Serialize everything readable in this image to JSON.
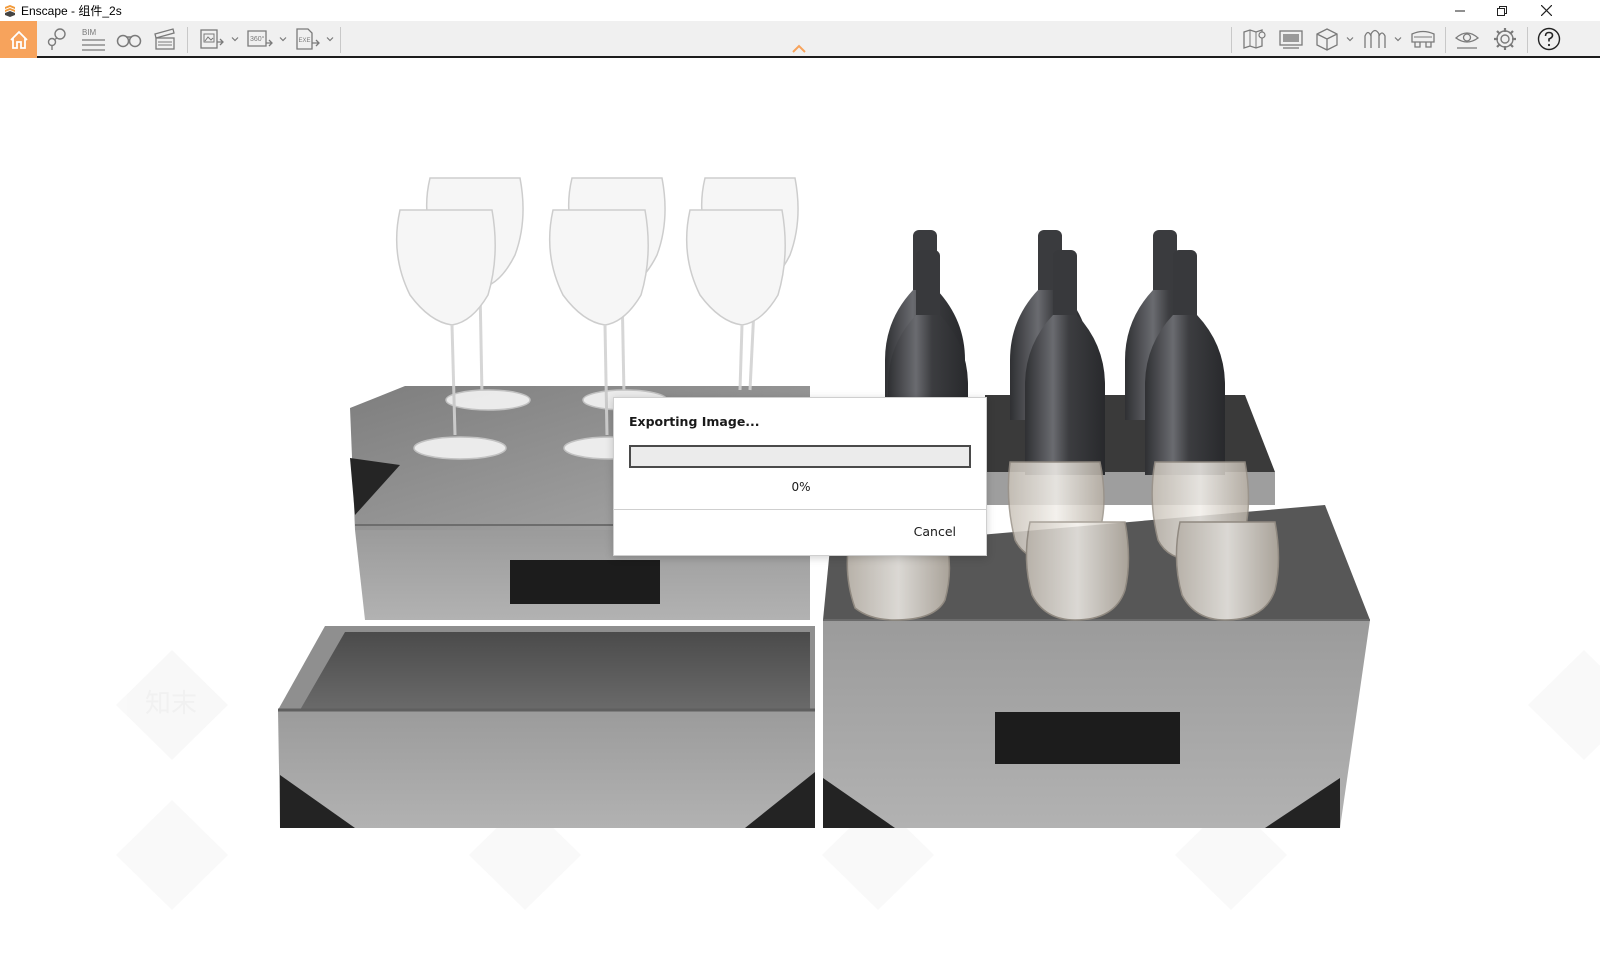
{
  "window": {
    "title": "Enscape - 组件_2s",
    "accent_color": "#f7a35c",
    "controls": [
      "minimize-icon",
      "restore-icon",
      "close-icon"
    ]
  },
  "toolbar": {
    "left_tools": [
      {
        "name": "home",
        "icon": "home-icon",
        "active": true
      },
      {
        "name": "views",
        "icon": "map-pin-icon"
      },
      {
        "name": "bim",
        "icon": "bim-icon",
        "label": "BIM"
      },
      {
        "name": "binoculars",
        "icon": "binoculars-icon"
      },
      {
        "name": "video",
        "icon": "clapperboard-icon"
      },
      {
        "name": "screenshot",
        "icon": "image-export-icon",
        "dropdown": true
      },
      {
        "name": "panorama",
        "icon": "panorama-360-icon",
        "label": "360°",
        "dropdown": true
      },
      {
        "name": "exe",
        "icon": "exe-export-icon",
        "label": "EXE",
        "dropdown": true
      }
    ],
    "right_tools": [
      {
        "name": "map",
        "icon": "map-icon"
      },
      {
        "name": "monitor",
        "icon": "monitor-icon"
      },
      {
        "name": "cube",
        "icon": "cube-icon",
        "dropdown": true
      },
      {
        "name": "asset",
        "icon": "asset-icon",
        "dropdown": true
      },
      {
        "name": "vr",
        "icon": "vr-headset-icon"
      },
      {
        "name": "eye",
        "icon": "eye-icon"
      },
      {
        "name": "settings",
        "icon": "gear-icon"
      },
      {
        "name": "help",
        "icon": "help-icon"
      }
    ]
  },
  "dialog": {
    "title": "Exporting Image...",
    "progress": 0,
    "progress_text": "0%",
    "cancel_label": "Cancel"
  },
  "watermark": {
    "text": "知末"
  }
}
